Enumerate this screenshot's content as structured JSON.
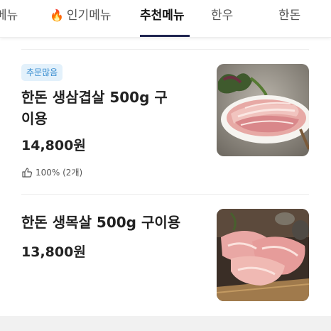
{
  "tabs": [
    {
      "label": "메뉴",
      "icon": null
    },
    {
      "label": "인기메뉴",
      "icon": "fire-icon"
    },
    {
      "label": "추천메뉴",
      "icon": null,
      "active": true
    },
    {
      "label": "한우",
      "icon": null
    },
    {
      "label": "한돈",
      "icon": null
    }
  ],
  "items": [
    {
      "badge": "추문많음",
      "title": "한돈 생삼겹살 500g 구이용",
      "price": "14,800원",
      "likes": "100% (2개)",
      "image": "pork-belly-photo"
    },
    {
      "title": "한돈 생목살 500g 구이용",
      "price": "13,800원",
      "image": "pork-neck-photo"
    }
  ],
  "colors": {
    "accent": "#1f2450",
    "badge_bg": "#e3f1fb",
    "badge_text": "#3b8fd1"
  }
}
